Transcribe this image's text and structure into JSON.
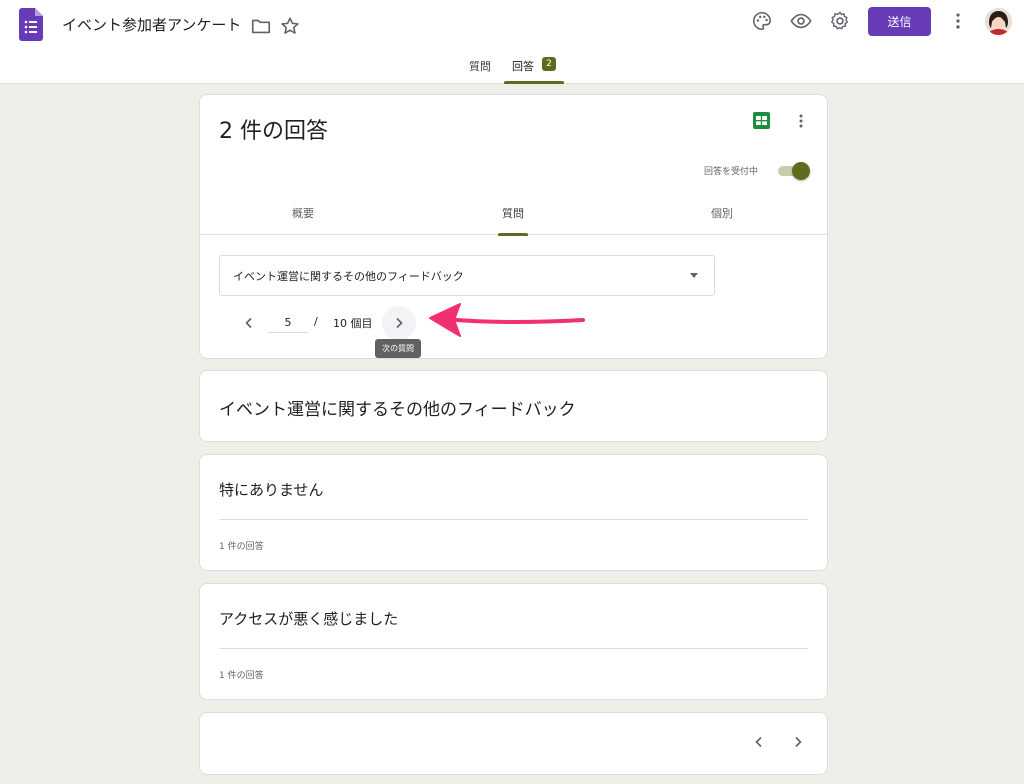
{
  "header": {
    "form_title": "イベント参加者アンケート",
    "send_label": "送信",
    "brand_color": "#673ab7",
    "accent_color": "#5f6b1f"
  },
  "main_tabs": {
    "questions_label": "質問",
    "responses_label": "回答",
    "responses_count": "2"
  },
  "summary": {
    "title": "2 件の回答",
    "accepting_label": "回答を受付中"
  },
  "sub_tabs": {
    "summary_label": "概要",
    "question_label": "質問",
    "individual_label": "個別"
  },
  "question_select": {
    "selected": "イベント運営に関するその他のフィードバック"
  },
  "pager": {
    "current": "5",
    "separator": "/",
    "total_label": "10 個目",
    "next_tooltip": "次の質問"
  },
  "question_card": {
    "title": "イベント運営に関するその他のフィードバック"
  },
  "answers": [
    {
      "text": "特にありません",
      "count_label": "1 件の回答"
    },
    {
      "text": "アクセスが悪く感じました",
      "count_label": "1 件の回答"
    }
  ],
  "icons": {
    "logo": "google-forms-icon",
    "folder": "folder-icon",
    "star": "star-icon",
    "palette": "palette-icon",
    "preview": "eye-icon",
    "settings": "gear-icon",
    "more": "more-vert-icon",
    "sheets": "google-sheets-icon"
  }
}
